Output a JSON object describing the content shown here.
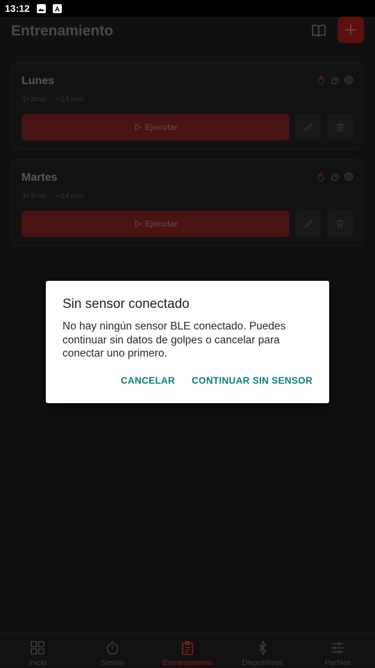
{
  "status_bar": {
    "time": "13:12"
  },
  "header": {
    "title": "Entrenamiento",
    "add_label": "+"
  },
  "workouts": [
    {
      "name": "Lunes",
      "rounds": "3×3min",
      "duration": "≈14 min",
      "run_label": "Ejecutar"
    },
    {
      "name": "Martes",
      "rounds": "3×3min",
      "duration": "≈14 min",
      "run_label": "Ejecutar"
    }
  ],
  "meta_separator": "·",
  "dialog": {
    "title": "Sin sensor conectado",
    "message": "No hay ningún sensor BLE conectado. Puedes continuar sin datos de golpes o cancelar para conectar uno primero.",
    "cancel_label": "CANCELAR",
    "continue_label": "CONTINUAR SIN SENSOR"
  },
  "bottom_nav": {
    "items": [
      {
        "label": "Inicio",
        "icon": "grid-icon"
      },
      {
        "label": "Sesión",
        "icon": "stopwatch-icon"
      },
      {
        "label": "Entrenamiento",
        "icon": "clipboard-icon",
        "active": true
      },
      {
        "label": "Dispositivos",
        "icon": "bluetooth-icon"
      },
      {
        "label": "Perfiles",
        "icon": "sliders-icon"
      }
    ]
  },
  "colors": {
    "accent": "#a82424",
    "dialog_action": "#0e7f78",
    "background": "#141414"
  }
}
